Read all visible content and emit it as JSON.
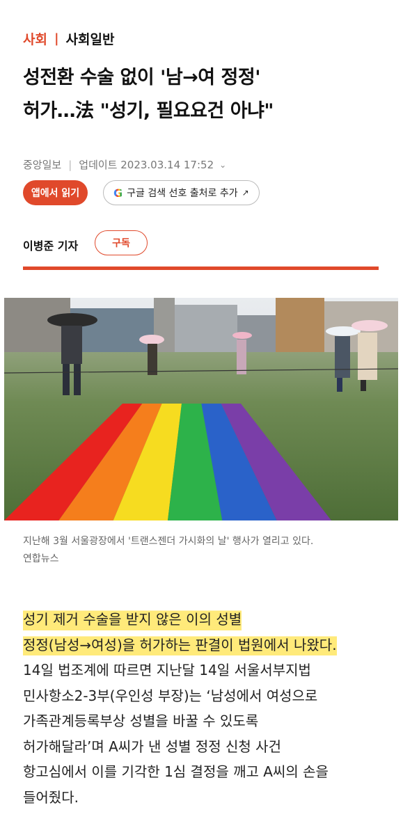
{
  "section": {
    "category": "사회",
    "separator": "|",
    "subcategory": "사회일반"
  },
  "headline": {
    "line1": "성전환 수술 없이 '남→여 정정'",
    "line2": "허가…法 \"성기, 필요요건 아냐\""
  },
  "meta": {
    "source": "중앙일보",
    "divider": "|",
    "updated": "업데이트 2023.03.14 17:52"
  },
  "buttons": {
    "app_read": "앱에서 읽기",
    "google_letter": "G",
    "google_pref": "구글 검색 선호 출처로 추가",
    "subscribe": "구독"
  },
  "reporter": {
    "name": "이병준 기자"
  },
  "photo": {
    "caption": "지난해 3월 서울광장에서 '트랜스젠더 가시화의 날' 행사가 열리고 있다.",
    "credit": "연합뉴스",
    "flag_colors": [
      "#e8231f",
      "#f57e1c",
      "#f6dc20",
      "#2db24a",
      "#2a62c9",
      "#7a3ea8"
    ]
  },
  "article": {
    "highlight_line1": "성기 제거 수술을 받지 않은 이의 성별",
    "highlight_line2": "정정(남성→여성)을 허가하는 판결이 법원에서 나왔다.",
    "lines": [
      "14일 법조계에 따르면 지난달 14일 서울서부지법",
      "민사항소2-3부(우인성 부장)는 ‘남성에서 여성으로",
      "가족관계등록부상 성별을 바꿀 수 있도록",
      "허가해달라’며 A씨가 낸 성별 정정 신청 사건",
      "항고심에서 이를 기각한 1심 결정을 깨고 A씨의 손을",
      "들어줬다."
    ]
  },
  "colors": {
    "accent": "#e0492b",
    "highlight": "#ffea7a"
  }
}
